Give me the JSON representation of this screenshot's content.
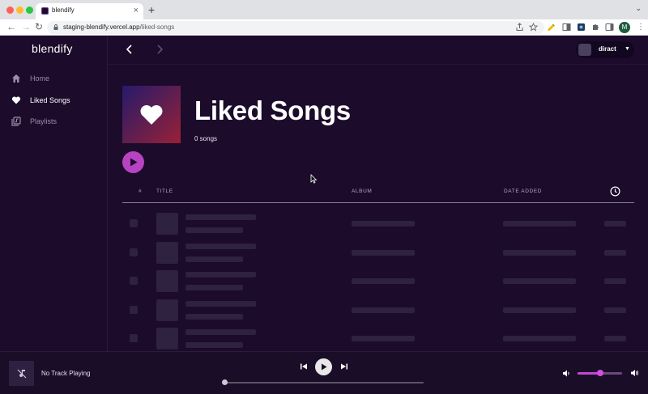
{
  "browser": {
    "tab_title": "blendify",
    "tab_close": "×",
    "new_tab": "+",
    "url_host": "staging-blendify.vercel.app",
    "url_path": "/liked-songs",
    "profile_initial": "M"
  },
  "app": {
    "logo": "blendify",
    "nav": [
      {
        "label": "Home",
        "icon": "home-icon",
        "active": false
      },
      {
        "label": "Liked Songs",
        "icon": "heart-icon",
        "active": true
      },
      {
        "label": "Playlists",
        "icon": "playlist-icon",
        "active": false
      }
    ],
    "user": {
      "name": "diract"
    }
  },
  "page": {
    "title": "Liked Songs",
    "song_count": "0 songs",
    "table_headers": {
      "number": "#",
      "title": "TITLE",
      "album": "ALBUM",
      "date_added": "DATE ADDED"
    },
    "skeleton_rows": 5
  },
  "player": {
    "now_playing": "No Track Playing",
    "progress": 0,
    "volume": 0.5
  },
  "colors": {
    "background": "#1c0b2b",
    "accent": "#b743c3",
    "skeleton": "#2f2140"
  }
}
